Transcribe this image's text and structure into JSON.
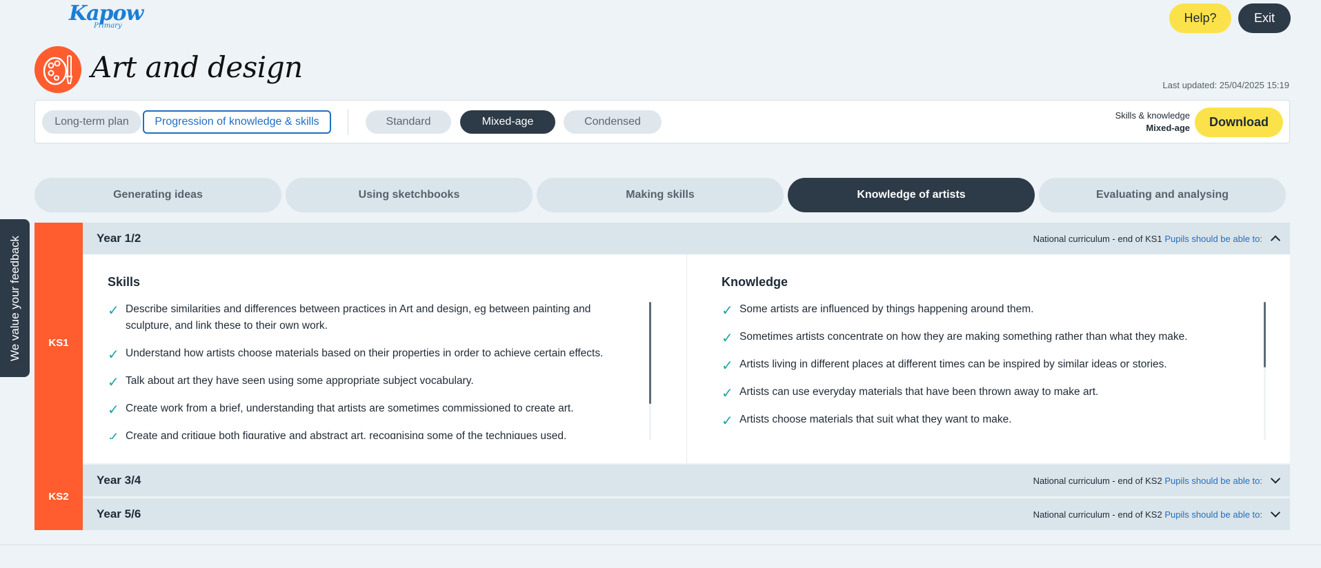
{
  "header": {
    "logo_text": "Kapow",
    "logo_sub": "Primary",
    "help_label": "Help?",
    "exit_label": "Exit",
    "subject_title": "Art and design",
    "last_updated": "Last updated: 25/04/2025 15:19"
  },
  "toolbar": {
    "plan_tabs": [
      "Long-term plan",
      "Progression of knowledge & skills"
    ],
    "plan_selected": "Progression of knowledge & skills",
    "format_tabs": [
      "Standard",
      "Mixed-age",
      "Condensed"
    ],
    "format_selected": "Mixed-age",
    "download_caption_line1": "Skills & knowledge",
    "download_caption_line2": "Mixed-age",
    "download_label": "Download"
  },
  "strands": {
    "tabs": [
      "Generating ideas",
      "Using sketchbooks",
      "Making skills",
      "Knowledge of artists",
      "Evaluating and analysing"
    ],
    "selected": "Knowledge of artists"
  },
  "feedback": {
    "label": "We value your feedback"
  },
  "stages": {
    "ks1": {
      "label": "KS1",
      "year": "Year 1/2",
      "nc_text": "National curriculum - end of KS1",
      "nc_link": "Pupils should be able to:",
      "skills_title": "Skills",
      "skills": [
        "Describe similarities and differences between practices in Art and design, eg between painting and sculpture, and link these to their own work.",
        "Understand how artists choose materials based on their properties in order to achieve certain effects.",
        "Talk about art they have seen using some appropriate subject vocabulary.",
        "Create work from a brief, understanding that artists are sometimes commissioned to create art.",
        "Create and critique both figurative and abstract art, recognising some of the techniques used."
      ],
      "knowledge_title": "Knowledge",
      "knowledge": [
        "Some artists are influenced by things happening around them.",
        "Sometimes artists concentrate on how they are making something rather than what they make.",
        "Artists living in different places at different times can be inspired by similar ideas or stories.",
        "Artists can use everyday materials that have been thrown away to make art.",
        "Artists choose materials that suit what they want to make."
      ]
    },
    "ks2": {
      "label": "KS2",
      "years": [
        {
          "year": "Year 3/4",
          "nc_text": "National curriculum - end of KS2",
          "nc_link": "Pupils should be able to:"
        },
        {
          "year": "Year 5/6",
          "nc_text": "National curriculum - end of KS2",
          "nc_link": "Pupils should be able to:"
        }
      ]
    }
  },
  "icons": {
    "check": "check-icon",
    "chevron_up": "chevron-up-icon",
    "chevron_down": "chevron-down-icon",
    "palette": "palette-icon"
  },
  "colors": {
    "accent_orange": "#ff5c30",
    "dark_navy": "#2d3a48",
    "yellow": "#fce24a",
    "link_blue": "#1f6fc0",
    "check_teal": "#1ea3a8"
  }
}
